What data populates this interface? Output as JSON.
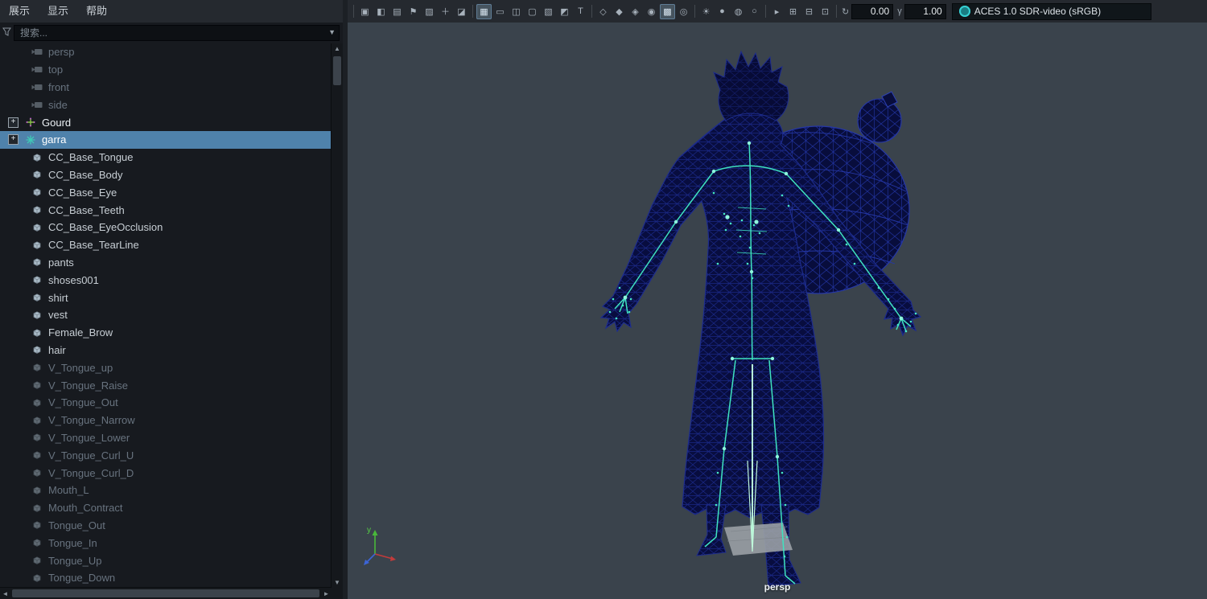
{
  "top_bar": {
    "menus": [
      {
        "label": "展示"
      },
      {
        "label": "显示"
      },
      {
        "label": "帮助"
      }
    ]
  },
  "outliner": {
    "search_placeholder": "搜索...",
    "items": [
      {
        "label": "persp",
        "icon": "camera",
        "muted": true,
        "indent": 1
      },
      {
        "label": "top",
        "icon": "camera",
        "muted": true,
        "indent": 1
      },
      {
        "label": "front",
        "icon": "camera",
        "muted": true,
        "indent": 1
      },
      {
        "label": "side",
        "icon": "camera",
        "muted": true,
        "indent": 1
      },
      {
        "label": "Gourd",
        "icon": "transform",
        "expandable": true,
        "bright": true,
        "indent": 0
      },
      {
        "label": "garra",
        "icon": "joint",
        "expandable": true,
        "selected": true,
        "indent": 0
      },
      {
        "label": "CC_Base_Tongue",
        "icon": "mesh",
        "indent": 1
      },
      {
        "label": "CC_Base_Body",
        "icon": "mesh",
        "indent": 1
      },
      {
        "label": "CC_Base_Eye",
        "icon": "mesh",
        "indent": 1
      },
      {
        "label": "CC_Base_Teeth",
        "icon": "mesh",
        "indent": 1
      },
      {
        "label": "CC_Base_EyeOcclusion",
        "icon": "mesh",
        "indent": 1
      },
      {
        "label": "CC_Base_TearLine",
        "icon": "mesh",
        "indent": 1
      },
      {
        "label": "pants",
        "icon": "mesh",
        "indent": 1
      },
      {
        "label": "shoses001",
        "icon": "mesh",
        "indent": 1
      },
      {
        "label": "shirt",
        "icon": "mesh",
        "indent": 1
      },
      {
        "label": "vest",
        "icon": "mesh",
        "indent": 1
      },
      {
        "label": "Female_Brow",
        "icon": "mesh",
        "indent": 1
      },
      {
        "label": "hair",
        "icon": "mesh",
        "indent": 1
      },
      {
        "label": "V_Tongue_up",
        "icon": "mesh",
        "muted": true,
        "indent": 1
      },
      {
        "label": "V_Tongue_Raise",
        "icon": "mesh",
        "muted": true,
        "indent": 1
      },
      {
        "label": "V_Tongue_Out",
        "icon": "mesh",
        "muted": true,
        "indent": 1
      },
      {
        "label": "V_Tongue_Narrow",
        "icon": "mesh",
        "muted": true,
        "indent": 1
      },
      {
        "label": "V_Tongue_Lower",
        "icon": "mesh",
        "muted": true,
        "indent": 1
      },
      {
        "label": "V_Tongue_Curl_U",
        "icon": "mesh",
        "muted": true,
        "indent": 1
      },
      {
        "label": "V_Tongue_Curl_D",
        "icon": "mesh",
        "muted": true,
        "indent": 1
      },
      {
        "label": "Mouth_L",
        "icon": "mesh",
        "muted": true,
        "indent": 1
      },
      {
        "label": "Mouth_Contract",
        "icon": "mesh",
        "muted": true,
        "indent": 1
      },
      {
        "label": "Tongue_Out",
        "icon": "mesh",
        "muted": true,
        "indent": 1
      },
      {
        "label": "Tongue_In",
        "icon": "mesh",
        "muted": true,
        "indent": 1
      },
      {
        "label": "Tongue_Up",
        "icon": "mesh",
        "muted": true,
        "indent": 1
      },
      {
        "label": "Tongue_Down",
        "icon": "mesh",
        "muted": true,
        "indent": 1
      }
    ]
  },
  "viewport": {
    "camera_label": "persp",
    "axis_label_y": "y",
    "toolbar": {
      "icons": [
        {
          "sep": true
        },
        {
          "name": "select-camera-icon",
          "glyph": "▣"
        },
        {
          "name": "lock-camera-icon",
          "glyph": "◧"
        },
        {
          "name": "camera-attributes-icon",
          "glyph": "▤"
        },
        {
          "name": "bookmark-icon",
          "glyph": "⚑"
        },
        {
          "name": "image-plane-icon",
          "glyph": "▨"
        },
        {
          "name": "2d-pan-zoom-icon",
          "glyph": "＋"
        },
        {
          "name": "grease-pencil-icon",
          "glyph": "◪"
        },
        {
          "sep": true
        },
        {
          "name": "grid-icon",
          "glyph": "▦",
          "active": true
        },
        {
          "name": "film-gate-icon",
          "glyph": "▭"
        },
        {
          "name": "resolution-gate-icon",
          "glyph": "◫"
        },
        {
          "name": "gate-mask-icon",
          "glyph": "▢"
        },
        {
          "name": "field-chart-icon",
          "glyph": "▧"
        },
        {
          "name": "safe-action-icon",
          "glyph": "◩"
        },
        {
          "name": "safe-title-icon",
          "glyph": "T"
        },
        {
          "sep": true
        },
        {
          "name": "wireframe-icon",
          "glyph": "◇"
        },
        {
          "name": "smooth-shade-icon",
          "glyph": "◆"
        },
        {
          "name": "textured-icon",
          "glyph": "◈"
        },
        {
          "name": "use-default-material-icon",
          "glyph": "◉"
        },
        {
          "name": "wireframe-on-shaded-icon",
          "glyph": "▩",
          "active": true
        },
        {
          "name": "xray-icon",
          "glyph": "◎"
        },
        {
          "sep": true
        },
        {
          "name": "lighting-icon",
          "glyph": "☀"
        },
        {
          "name": "shadows-icon",
          "glyph": "●"
        },
        {
          "name": "ambient-occlusion-icon",
          "glyph": "◍"
        },
        {
          "name": "anti-alias-icon",
          "glyph": "○"
        },
        {
          "sep": true
        },
        {
          "name": "isolate-select-icon",
          "glyph": "▸"
        },
        {
          "name": "pane-layout-icon",
          "glyph": "⊞"
        },
        {
          "name": "split-view-icon",
          "glyph": "⊟"
        },
        {
          "name": "snapshot-icon",
          "glyph": "⊡"
        },
        {
          "sep": true
        }
      ],
      "exposure_icon_glyph": "↻",
      "exposure_value": "0.00",
      "gamma_icon_glyph": "γ",
      "gamma_value": "1.00",
      "colorspace": "ACES 1.0 SDR-video (sRGB)"
    }
  },
  "colors": {
    "selection_highlight": "#4f82ab",
    "wireframe_navy": "#0a0f4a",
    "skeleton_cyan": "#3fe3c0",
    "viewport_background": "#3a434c"
  }
}
